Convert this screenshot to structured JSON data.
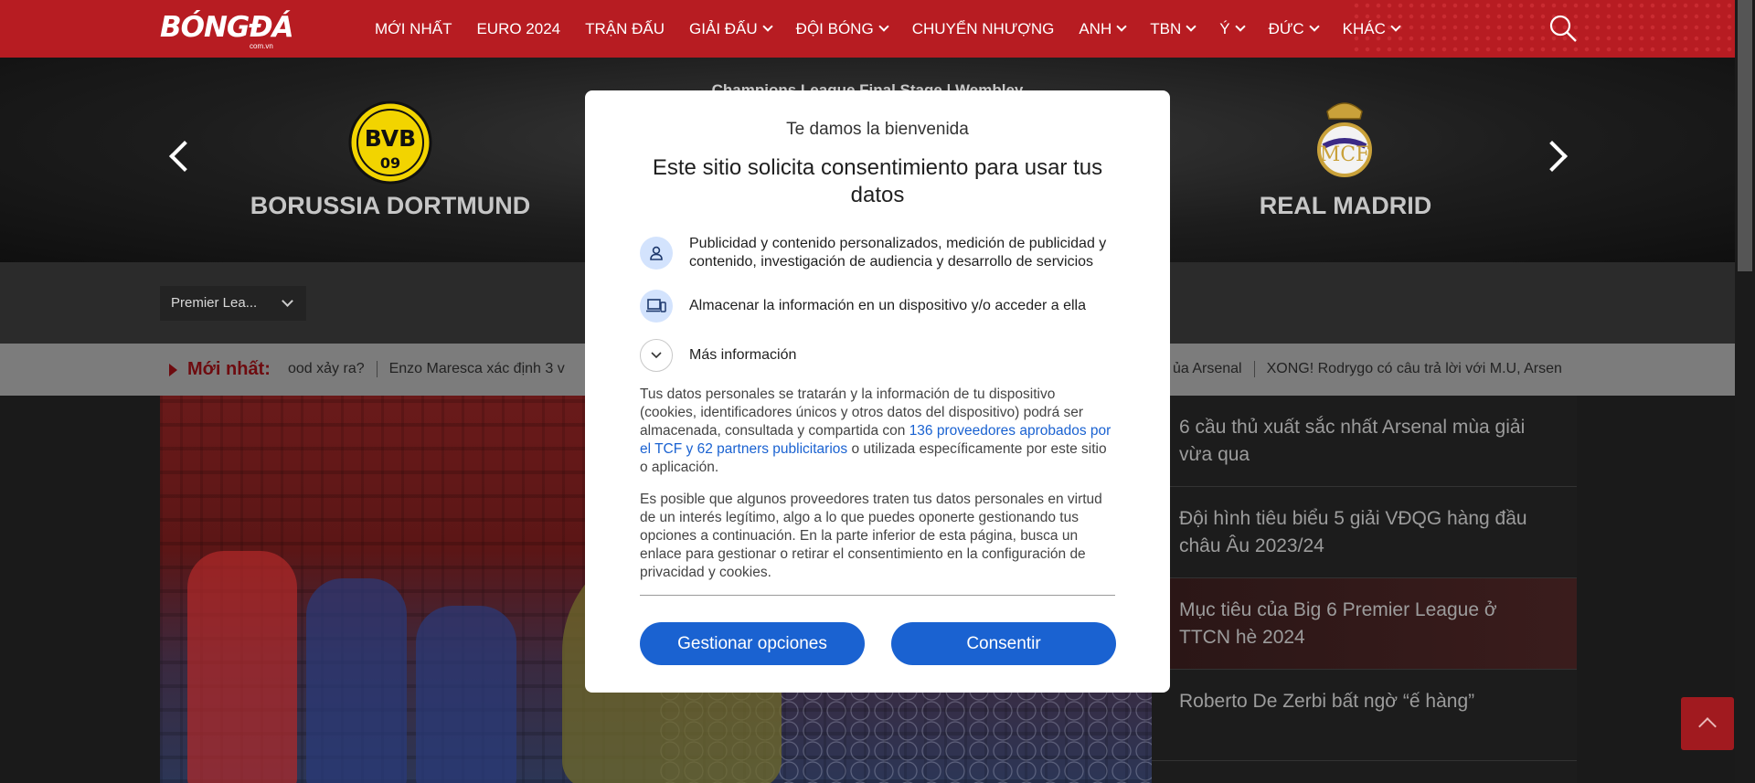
{
  "header": {
    "logo_text": "BÓNGĐÁ",
    "logo_sub": "com.vn",
    "nav": [
      {
        "label": "MỚI NHẤT",
        "dropdown": false
      },
      {
        "label": "EURO 2024",
        "dropdown": false
      },
      {
        "label": "TRẬN ĐẤU",
        "dropdown": false
      },
      {
        "label": "GIẢI ĐẤU",
        "dropdown": true
      },
      {
        "label": "ĐỘI BÓNG",
        "dropdown": true
      },
      {
        "label": "CHUYỂN NHƯỢNG",
        "dropdown": false
      },
      {
        "label": "ANH",
        "dropdown": true
      },
      {
        "label": "TBN",
        "dropdown": true
      },
      {
        "label": "Ý",
        "dropdown": true
      },
      {
        "label": "ĐỨC",
        "dropdown": true
      },
      {
        "label": "KHÁC",
        "dropdown": true
      }
    ],
    "search_icon": "search-icon"
  },
  "match": {
    "title": "Champions League Final Stage | Wembley",
    "home_team": "BORUSSIA DORTMUND",
    "away_team": "REAL MADRID",
    "home_logo_text": "BVB",
    "home_logo_sub": "09"
  },
  "filter": {
    "league_select": "Premier Lea..."
  },
  "ticker": {
    "label": "Mới nhất:",
    "items": [
      "ood xảy ra?",
      "Enzo Maresca xác định 3 v",
      "ủa Arsenal",
      "XONG! Rodrygo có câu trả lời với M.U, Arsen"
    ]
  },
  "side_news": [
    "6 cầu thủ xuất sắc nhất Arsenal mùa giải vừa qua",
    "Đội hình tiêu biểu 5 giải VĐQG hàng đầu châu Âu 2023/24",
    "Mục tiêu của Big 6 Premier League ở TTCN hè 2024",
    "Roberto De Zerbi bất ngờ “ế hàng”"
  ],
  "consent": {
    "welcome": "Te damos la bienvenida",
    "title": "Este sitio solicita consentimiento para usar tus datos",
    "purposes": [
      "Publicidad y contenido personalizados, medición de publicidad y contenido, investigación de audiencia y desarrollo de servicios",
      "Almacenar la información en un dispositivo y/o acceder a ella"
    ],
    "more_info": "Más información",
    "para1_before": "Tus datos personales se tratarán y la información de tu dispositivo (cookies, identificadores únicos y otros datos del dispositivo) podrá ser almacenada, consultada y compartida con ",
    "para1_link": "136 proveedores aprobados por el TCF y 62 partners publicitarios",
    "para1_after": " o utilizada específicamente por este sitio o aplicación.",
    "para2": "Es posible que algunos proveedores traten tus datos personales en virtud de un interés legítimo, algo a lo que puedes oponerte gestionando tus opciones a continuación. En la parte inferior de esta página, busca un enlace para gestionar o retirar el consentimiento en la configuración de privacidad y cookies.",
    "manage_button": "Gestionar opciones",
    "consent_button": "Consentir"
  },
  "colors": {
    "brand_red": "#b71c22",
    "consent_blue": "#1a62d1"
  }
}
